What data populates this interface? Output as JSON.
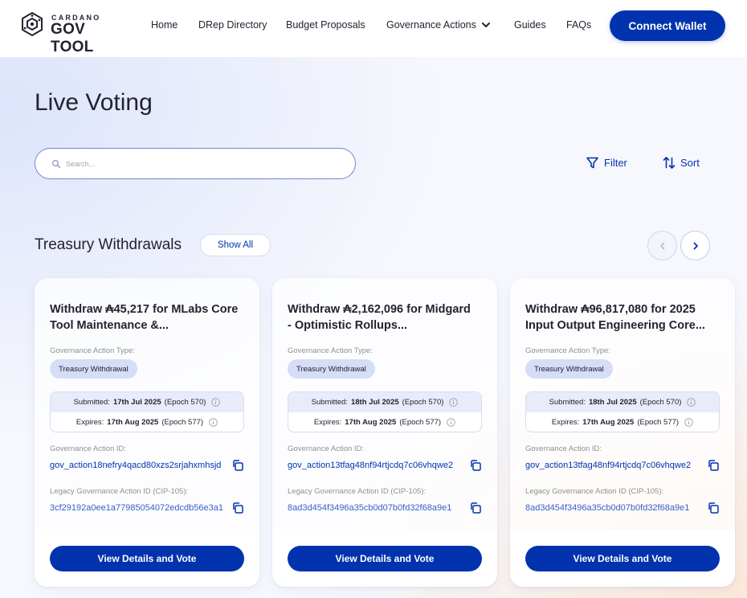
{
  "header": {
    "logo_small": "CARDANO",
    "logo_big": "GOV TOOL",
    "nav": [
      "Home",
      "DRep Directory",
      "Budget Proposals",
      "Governance Actions",
      "Guides",
      "FAQs"
    ],
    "connect_label": "Connect Wallet"
  },
  "page": {
    "title": "Live Voting",
    "search_placeholder": "Search...",
    "filter_label": "Filter",
    "sort_label": "Sort"
  },
  "section": {
    "title": "Treasury Withdrawals",
    "show_all": "Show All"
  },
  "cards": [
    {
      "title_line1": "Withdraw ₳45,217 for MLabs Core",
      "title_line2": "Tool Maintenance &...",
      "type_label": "Governance Action Type:",
      "type": "Treasury Withdrawal",
      "submitted_label": "Submitted:",
      "submitted_date": "17th Jul 2025",
      "submitted_epoch": "(Epoch 570)",
      "expires_label": "Expires:",
      "expires_date": "17th Aug 2025",
      "expires_epoch": "(Epoch 577)",
      "id_label": "Governance Action ID:",
      "id": "gov_action18nefry4qacd80xzs2srjahxmhsjd",
      "legacy_label": "Legacy Governance Action ID (CIP-105):",
      "legacy_id": "3cf29192a0ee1a77985054072edcdb56e3a1",
      "button": "View Details and Vote"
    },
    {
      "title_line1": "Withdraw ₳2,162,096 for Midgard",
      "title_line2": "- Optimistic Rollups...",
      "type_label": "Governance Action Type:",
      "type": "Treasury Withdrawal",
      "submitted_label": "Submitted:",
      "submitted_date": "18th Jul 2025",
      "submitted_epoch": "(Epoch 570)",
      "expires_label": "Expires:",
      "expires_date": "17th Aug 2025",
      "expires_epoch": "(Epoch 577)",
      "id_label": "Governance Action ID:",
      "id": "gov_action13tfag48nf94rtjcdq7c06vhqwe2",
      "legacy_label": "Legacy Governance Action ID (CIP-105):",
      "legacy_id": "8ad3d454f3496a35cb0d07b0fd32f68a9e1",
      "button": "View Details and Vote"
    },
    {
      "title_line1": "Withdraw ₳96,817,080 for 2025",
      "title_line2": "Input Output Engineering Core...",
      "type_label": "Governance Action Type:",
      "type": "Treasury Withdrawal",
      "submitted_label": "Submitted:",
      "submitted_date": "18th Jul 2025",
      "submitted_epoch": "(Epoch 570)",
      "expires_label": "Expires:",
      "expires_date": "17th Aug 2025",
      "expires_epoch": "(Epoch 577)",
      "id_label": "Governance Action ID:",
      "id": "gov_action13tfag48nf94rtjcdq7c06vhqwe2",
      "legacy_label": "Legacy Governance Action ID (CIP-105):",
      "legacy_id": "8ad3d454f3496a35cb0d07b0fd32f68a9e1",
      "button": "View Details and Vote"
    }
  ],
  "colors": {
    "primary": "#0033ad",
    "text": "#242232",
    "muted": "#8e908e",
    "pill": "#d5ddf7"
  },
  "icons": {
    "logo": "cardano-govtool-logo-icon",
    "search": "search-icon",
    "filter": "filter-icon",
    "sort": "sort-icon",
    "prev": "chevron-left-icon",
    "next": "chevron-right-icon",
    "info": "info-icon",
    "copy": "copy-icon",
    "dropdown": "chevron-down-icon"
  }
}
